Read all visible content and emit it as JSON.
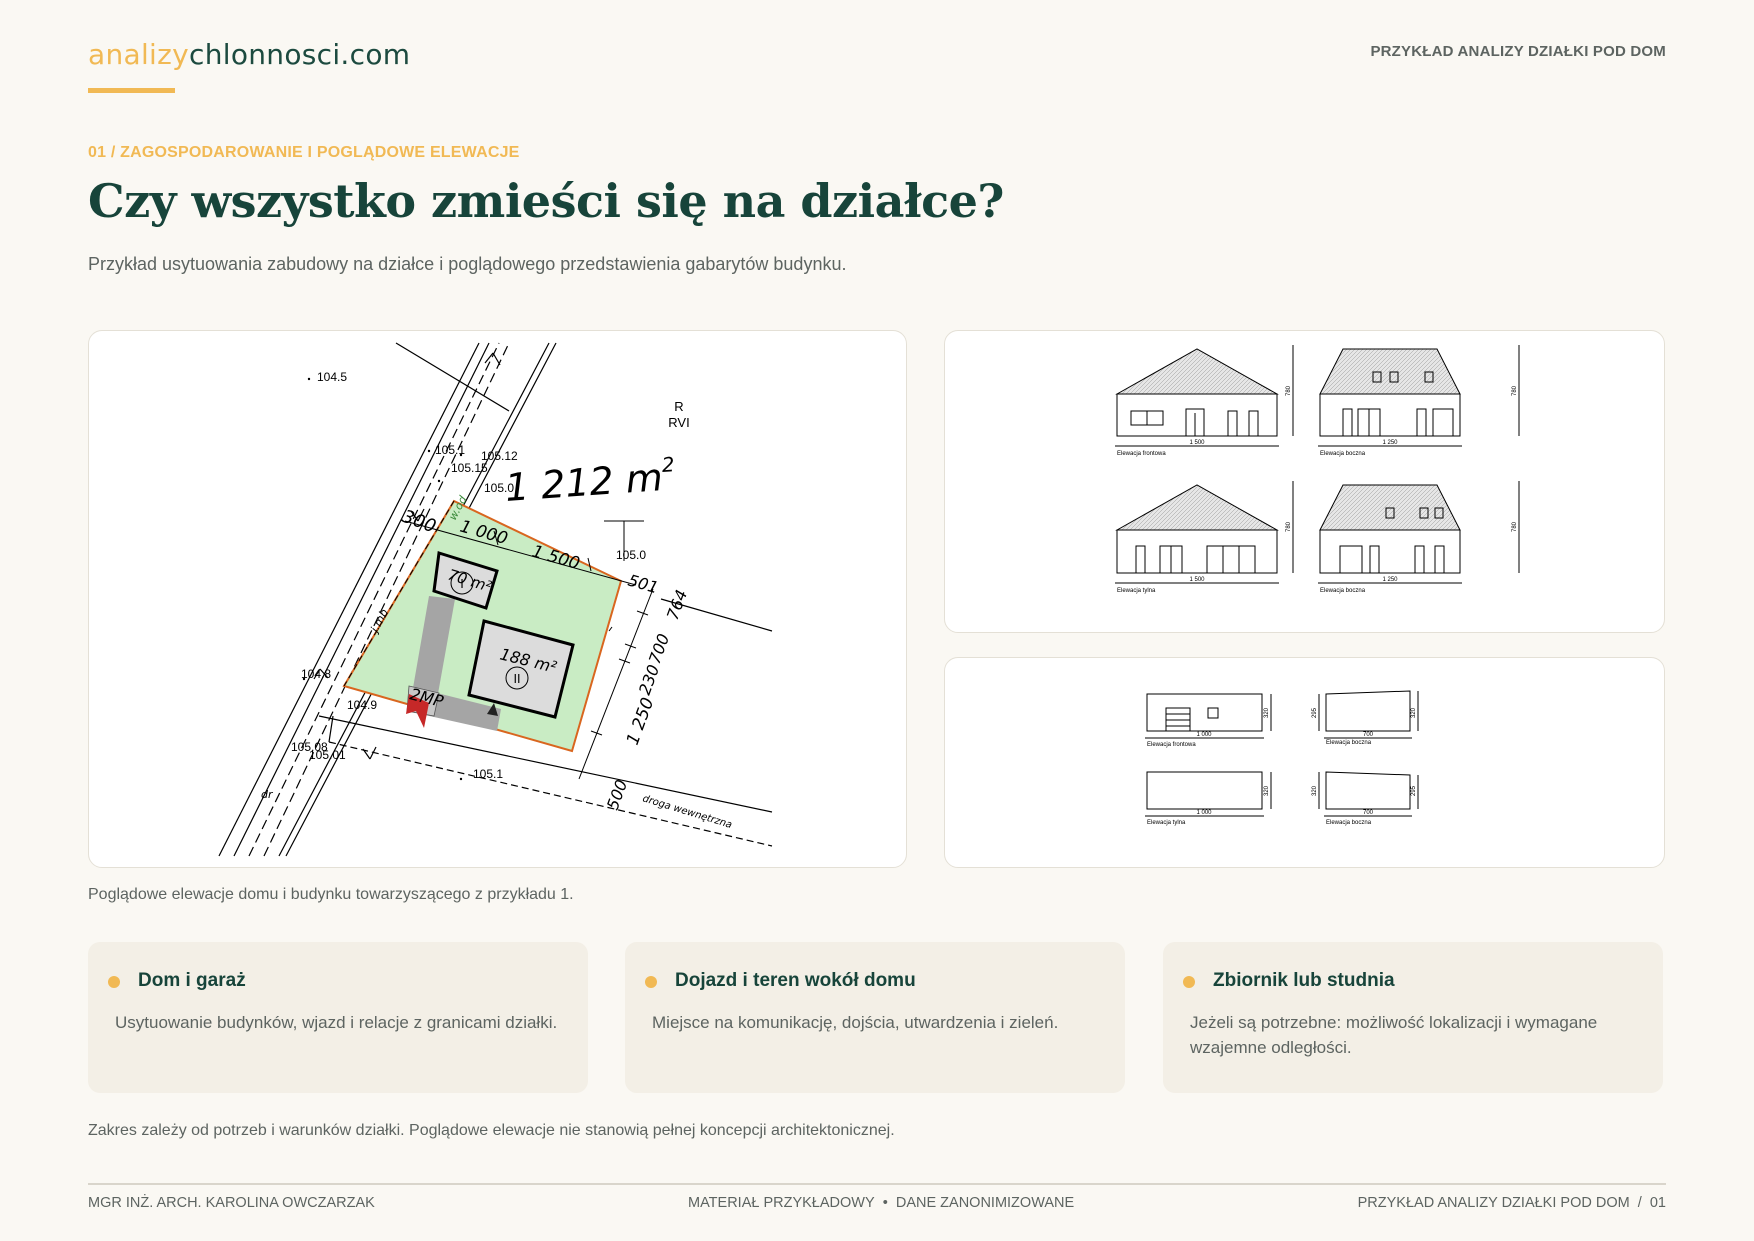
{
  "header": {
    "logo_part1": "analizy",
    "logo_part2": "chlonnosci.com",
    "top_right": "PRZYKŁAD ANALIZY DZIAŁKI POD DOM"
  },
  "section": {
    "kicker": "01 / ZAGOSPODAROWANIE I POGLĄDOWE ELEWACJE",
    "title": "Czy wszystko zmieści się na działce?",
    "subtitle": "Przykład usytuowania zabudowy na działce i poglądowego przedstawienia gabarytów budynku."
  },
  "site_plan": {
    "area_value": "1 212",
    "area_unit": "m",
    "area_exp": "2",
    "house_area": "188",
    "house_unit": "m²",
    "house_number": "II",
    "garage_area": "70",
    "garage_unit": "m²",
    "garage_number": "I",
    "parking": "2MP",
    "class_r": "R",
    "class_rvi": "RVI",
    "road_label": "droga wewnętrzna",
    "dims": {
      "d300": "300",
      "d1000": "1 000",
      "d1500": "1 500",
      "d501": "501",
      "d764": "764",
      "d700": "700",
      "d230": "230",
      "d1250": "1 250",
      "d500": "500"
    },
    "utility_labels": {
      "wod": "w.od",
      "jmb": "j.mb",
      "dr": "dr"
    },
    "spot_heights": {
      "h1045": "104.5",
      "h1051a": "105.1",
      "h10512": "105.12",
      "h10515": "105.15",
      "h1050a": "105.0",
      "h1050b": "105.0",
      "h1048": "104.8",
      "h1049": "104.9",
      "h10508": "105.08",
      "h10501": "105.01",
      "h1051b": "105.1"
    }
  },
  "house_elevations": {
    "front": "Elewacja frontowa",
    "side_a": "Elewacja boczna",
    "rear": "Elewacja tylna",
    "side_b": "Elewacja boczna",
    "dim_width_long": "1 500",
    "dim_width_short": "1 250",
    "dim_height": "780"
  },
  "garage_elevations": {
    "front": "Elewacja frontowa",
    "side_a": "Elewacja boczna",
    "rear": "Elewacja tylna",
    "side_b": "Elewacja boczna",
    "dim_width_long": "1 000",
    "dim_width_short": "700",
    "dim_height_a": "320",
    "dim_height_b": "295"
  },
  "caption": "Poglądowe elewacje domu i budynku towarzyszącego z przykładu 1.",
  "cards": [
    {
      "title": "Dom i garaż",
      "text": "Usytuowanie budynków, wjazd i relacje z granicami działki."
    },
    {
      "title": "Dojazd i teren wokół domu",
      "text": "Miejsce na komunikację, dojścia, utwardzenia i zieleń."
    },
    {
      "title": "Zbiornik lub studnia",
      "text": "Jeżeli są potrzebne: możliwość lokalizacji i wymagane wzajemne odległości."
    }
  ],
  "note": "Zakres zależy od potrzeb i warunków działki. Poglądowe elewacje nie stanowią pełnej koncepcji architektonicznej.",
  "footer": {
    "left": "MGR INŻ. ARCH. KAROLINA OWCZARZAK",
    "center_a": "MATERIAŁ PRZYKŁADOWY",
    "separator": "•",
    "center_b": "DANE ZANONIMIZOWANE",
    "right": "PRZYKŁAD ANALIZY DZIAŁKI POD DOM",
    "right_sep": "/",
    "page": "01"
  },
  "colors": {
    "brand_dark": "#1c4a3f",
    "brand_accent": "#f1b954",
    "plot_fill": "#c9ecc4",
    "plot_border": "#d9661f",
    "marker_red": "#c62828"
  }
}
